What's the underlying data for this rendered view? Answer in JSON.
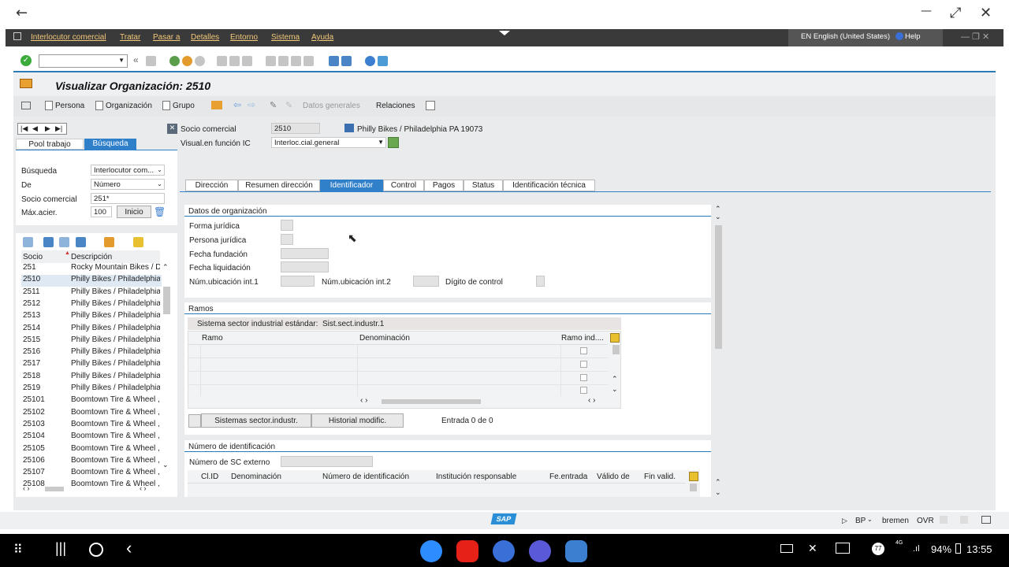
{
  "window": {
    "back": "←",
    "minimize": "—",
    "restore": "⤢",
    "close": "✕"
  },
  "menu": [
    "Interlocutor comercial",
    "Tratar",
    "Pasar a",
    "Detalles",
    "Entorno",
    "Sistema",
    "Ayuda"
  ],
  "lang": {
    "label": "EN English (United States)",
    "help": "Help"
  },
  "title": "Visualizar Organización: 2510",
  "app_toolbar": {
    "persona": "Persona",
    "organizacion": "Organización",
    "grupo": "Grupo",
    "datos_generales": "Datos generales",
    "relaciones": "Relaciones"
  },
  "header": {
    "socio_label": "Socio comercial",
    "socio_value": "2510",
    "socio_desc": "Philly Bikes / Philadelphia PA 19073",
    "visual_label": "Visual.en función IC",
    "visual_value": "Interloc.cial.general"
  },
  "left": {
    "tab_pool": "Pool trabajo",
    "tab_busqueda": "Búsqueda",
    "busqueda_label": "Búsqueda",
    "busqueda_value": "Interlocutor com...",
    "de_label": "De",
    "de_value": "Número",
    "socio_label": "Socio comercial",
    "socio_value": "251*",
    "max_label": "Máx.acier.",
    "max_value": "100",
    "inicio": "Inicio",
    "col_socio": "Socio",
    "col_desc": "Descripción",
    "rows": [
      {
        "id": "251",
        "desc": "Rocky Mountain Bikes / De"
      },
      {
        "id": "2510",
        "desc": "Philly Bikes / Philadelphia P"
      },
      {
        "id": "2511",
        "desc": "Philly Bikes / Philadelphia P"
      },
      {
        "id": "2512",
        "desc": "Philly Bikes / Philadelphia P"
      },
      {
        "id": "2513",
        "desc": "Philly Bikes / Philadelphia P"
      },
      {
        "id": "2514",
        "desc": "Philly Bikes / Philadelphia P"
      },
      {
        "id": "2515",
        "desc": "Philly Bikes / Philadelphia P"
      },
      {
        "id": "2516",
        "desc": "Philly Bikes / Philadelphia P"
      },
      {
        "id": "2517",
        "desc": "Philly Bikes / Philadelphia P"
      },
      {
        "id": "2518",
        "desc": "Philly Bikes / Philadelphia P"
      },
      {
        "id": "2519",
        "desc": "Philly Bikes / Philadelphia P"
      },
      {
        "id": "25101",
        "desc": "Boomtown Tire & Wheel ,"
      },
      {
        "id": "25102",
        "desc": "Boomtown Tire & Wheel ,"
      },
      {
        "id": "25103",
        "desc": "Boomtown Tire & Wheel ,"
      },
      {
        "id": "25104",
        "desc": "Boomtown Tire & Wheel ,"
      },
      {
        "id": "25105",
        "desc": "Boomtown Tire & Wheel ,"
      },
      {
        "id": "25106",
        "desc": "Boomtown Tire & Wheel ,"
      },
      {
        "id": "25107",
        "desc": "Boomtown Tire & Wheel ,"
      },
      {
        "id": "25108",
        "desc": "Boomtown Tire & Wheel ,"
      }
    ]
  },
  "tabs": [
    "Dirección",
    "Resumen dirección",
    "Identificador",
    "Control",
    "Pagos",
    "Status",
    "Identificación técnica"
  ],
  "org": {
    "title": "Datos de organización",
    "forma": "Forma jurídica",
    "persona": "Persona jurídica",
    "fundacion": "Fecha fundación",
    "liquidacion": "Fecha liquidación",
    "ubic1": "Núm.ubicación int.1",
    "ubic2": "Núm.ubicación int.2",
    "digito": "Dígito de control"
  },
  "ramos": {
    "title": "Ramos",
    "sistema_label": "Sistema sector industrial estándar:",
    "sistema_value": "Sist.sect.industr.1",
    "col_ramo": "Ramo",
    "col_denom": "Denominación",
    "col_ind": "Ramo ind....",
    "btn_sistemas": "Sistemas sector.industr.",
    "btn_historial": "Historial modific.",
    "entrada": "Entrada 0 de 0"
  },
  "ident": {
    "title": "Número de identificación",
    "externo": "Número de SC externo",
    "col_clid": "Cl.ID",
    "col_denom": "Denominación",
    "col_num": "Número de identificación",
    "col_inst": "Institución responsable",
    "col_fe": "Fe.entrada",
    "col_valido": "Válido de",
    "col_fin": "Fin valid."
  },
  "status": {
    "bp": "BP",
    "server": "bremen",
    "mode": "OVR",
    "sap": "SAP"
  },
  "android": {
    "notif": "77",
    "signal": "4G",
    "battery": "94%",
    "time": "13:55"
  }
}
